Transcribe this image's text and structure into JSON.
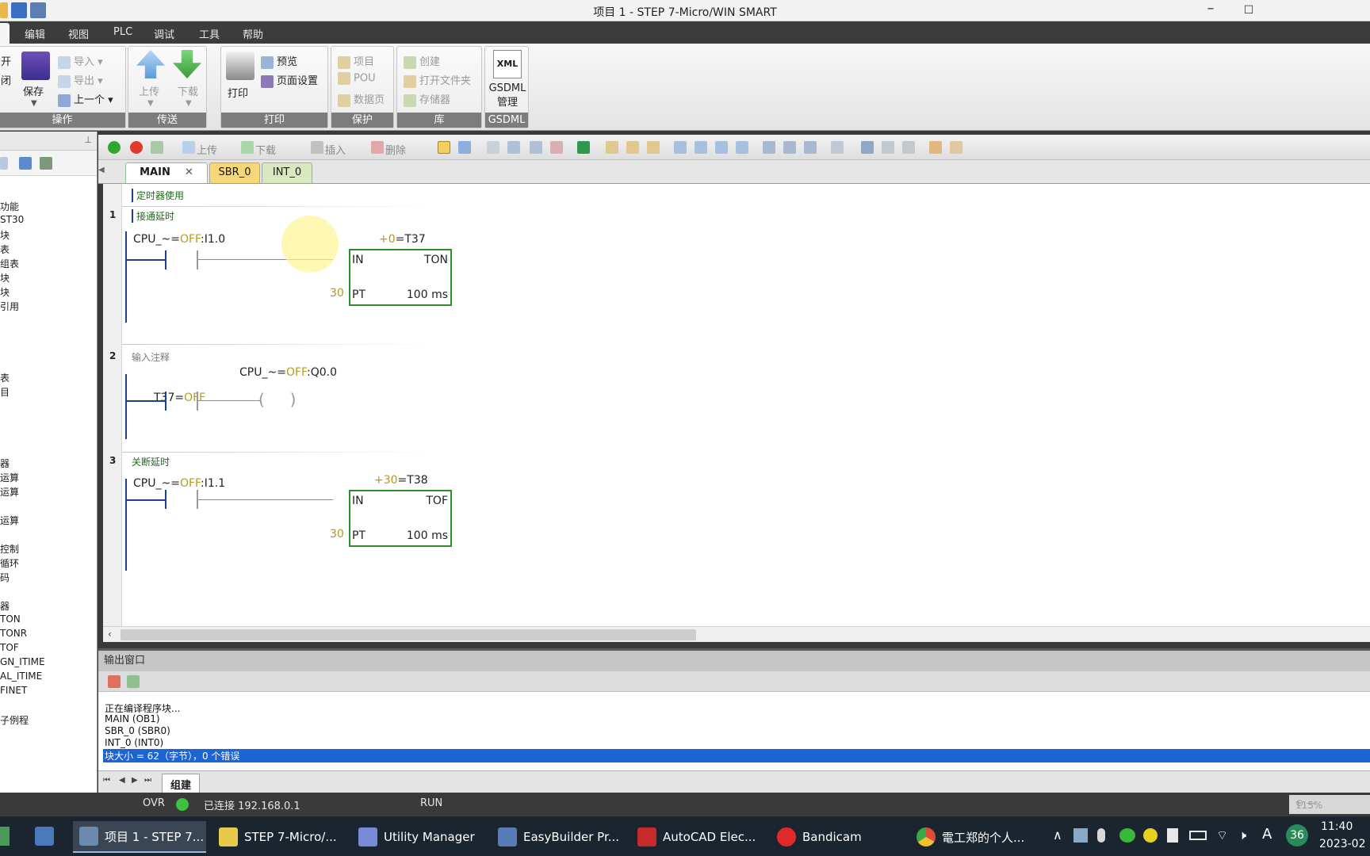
{
  "window": {
    "title": "项目 1 - STEP 7-Micro/WIN SMART"
  },
  "menu": [
    "编辑",
    "视图",
    "PLC",
    "调试",
    "工具",
    "帮助"
  ],
  "ribbon": {
    "ops": {
      "open_partial": "开",
      "close_partial": "闭",
      "save": "保存",
      "import": "导入",
      "export": "导出",
      "previous": "上一个",
      "group": "操作"
    },
    "transfer": {
      "upload": "上传",
      "download": "下载",
      "group": "传送"
    },
    "print": {
      "print": "打印",
      "preview": "预览",
      "page_setup": "页面设置",
      "group": "打印"
    },
    "protect": {
      "project": "项目",
      "pou": "POU",
      "datapage": "数据页",
      "group": "保护"
    },
    "library": {
      "create": "创建",
      "open_folder": "打开文件夹",
      "memory": "存储器",
      "group": "库"
    },
    "gsdml": {
      "label": "GSDML 管理",
      "group": "GSDML"
    }
  },
  "left_tree": [
    "功能",
    "ST30",
    "块",
    "表",
    "组表",
    "块",
    "块",
    "引用",
    "表",
    "目",
    "器",
    "运算",
    "运算",
    "运算",
    "控制",
    "循环",
    "码",
    "器",
    "TON",
    "TONR",
    "TOF",
    "GN_ITIME",
    "AL_ITIME",
    "FINET",
    "子例程"
  ],
  "editor_toolbar": {
    "upload": "上传",
    "download": "下载",
    "insert": "插入",
    "delete": "删除"
  },
  "tabs": [
    "MAIN",
    "SBR_0",
    "INT_0"
  ],
  "program_comment": "定时器使用",
  "networks": [
    {
      "num": "1",
      "title": "接通延时",
      "contact_label": "CPU_~=",
      "contact_state": "OFF",
      "contact_addr": ":I1.0",
      "timer_value": "+0",
      "timer_name": "=T37",
      "in": "IN",
      "type": "TON",
      "pt_value": "30",
      "pt": "PT",
      "base": "100 ms"
    },
    {
      "num": "2",
      "title": "输入注释",
      "contact_label": "T37=",
      "contact_state": "OFF",
      "coil_label": "CPU_~=",
      "coil_state": "OFF",
      "coil_addr": ":Q0.0"
    },
    {
      "num": "3",
      "title": "关断延时",
      "contact_label": "CPU_~=",
      "contact_state": "OFF",
      "contact_addr": ":I1.1",
      "timer_value": "+30",
      "timer_name": "=T38",
      "in": "IN",
      "type": "TOF",
      "pt_value": "30",
      "pt": "PT",
      "base": "100 ms"
    }
  ],
  "output": {
    "title": "输出窗口",
    "lines": [
      "正在编译程序块...",
      "MAIN (OB1)",
      "SBR_0 (SBR0)",
      "INT_0 (INT0)"
    ],
    "selected_line": "块大小 = 62（字节），0 个错误",
    "tab": "组建"
  },
  "status": {
    "ovr": "OVR",
    "connection": "已连接 192.168.0.1",
    "mode": "RUN",
    "zoom": "115%"
  },
  "taskbar": {
    "tasks": [
      "项目 1 - STEP 7...",
      "STEP 7-Micro/...",
      "Utility Manager",
      "EasyBuilder Pr...",
      "AutoCAD Elec...",
      "Bandicam",
      "電工郑的个人..."
    ],
    "tray_badge": "36",
    "ime": "A",
    "time": "11:40",
    "date": "2023-02"
  },
  "colors": {
    "rail": "#1f3f8f",
    "box": "#2f8f2f",
    "off": "#b59a2a",
    "selection": "#1c64d4"
  }
}
